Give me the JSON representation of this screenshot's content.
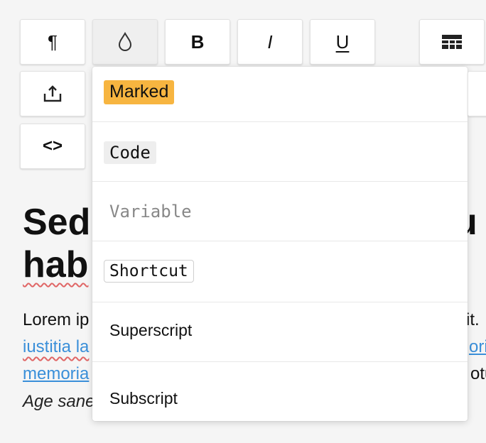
{
  "toolbar": {
    "row1": [
      {
        "name": "paragraph-button",
        "icon": "pilcrow-icon",
        "text": "¶"
      },
      {
        "name": "text-style-button",
        "icon": "droplet-icon"
      },
      {
        "name": "bold-button",
        "icon": "bold-icon",
        "text": "B"
      },
      {
        "name": "italic-button",
        "icon": "italic-icon",
        "text": "I"
      },
      {
        "name": "underline-button",
        "icon": "underline-icon",
        "text": "U"
      },
      {
        "name": "table-button",
        "icon": "table-icon"
      }
    ],
    "row2": [
      {
        "name": "share-button",
        "icon": "share-icon"
      }
    ],
    "row3": [
      {
        "name": "code-view-button",
        "icon": "code-icon",
        "text": "<>"
      }
    ]
  },
  "document": {
    "title_line1": "Sed",
    "title_line1_tail": "u",
    "title_line2": "hab",
    "para_line1_start": "Lorem ip",
    "para_line1_end": "it.",
    "para_line2_start": "iustitia la",
    "para_line2_end": "ori",
    "para_line3_start": "memoria",
    "para_line3_end": "otu",
    "para_line4_start": "Age sane"
  },
  "text_style_menu": {
    "items": [
      {
        "label": "Marked",
        "style": "marked"
      },
      {
        "label": "Code",
        "style": "code"
      },
      {
        "label": "Variable",
        "style": "variable"
      },
      {
        "label": "Shortcut",
        "style": "shortcut"
      },
      {
        "label": "Superscript",
        "style": "superscript"
      },
      {
        "label": "Subscript",
        "style": "subscript"
      }
    ]
  },
  "colors": {
    "marked": "#f7b540",
    "link": "#3a8fd9",
    "spellcheck": "#e06666"
  }
}
